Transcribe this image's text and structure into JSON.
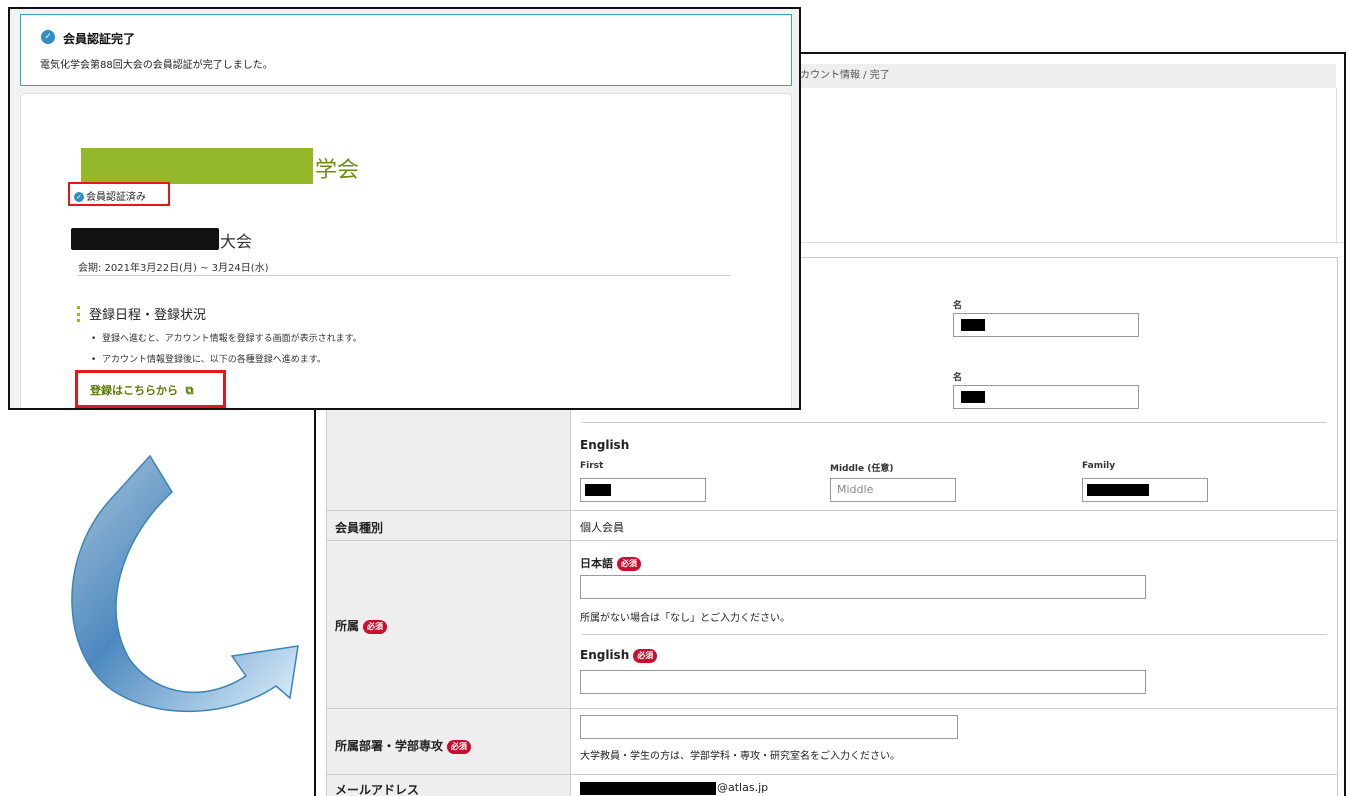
{
  "breadcrumb": "カウント情報 / 完了",
  "verify": {
    "alert_title": "会員認証完了",
    "alert_text": "電気化学会第88回大会の会員認証が完了しました。",
    "society_suffix": "学会",
    "verified_badge": "会員認証済み",
    "conference_suffix": "大会",
    "period": "会期: 2021年3月22日(月) ~ 3月24日(水)",
    "section_title": "登録日程・登録状況",
    "bullets": [
      "登録へ進むと、アカウント情報を登録する画面が表示されます。",
      "アカウント情報登録後に、以下の各種登録へ進めます。"
    ],
    "register_button": "登録はこちらから",
    "register_icon": "external-link-icon"
  },
  "form": {
    "given_name_label_1": "名",
    "given_name_label_2": "名",
    "english_label": "English",
    "first_label": "First",
    "middle_label": "Middle (任意)",
    "middle_placeholder": "Middle",
    "family_label": "Family",
    "membership_label": "会員種別",
    "membership_value": "個人会員",
    "affiliation_label": "所属",
    "affiliation_jp_label": "日本語",
    "affiliation_note": "所属がない場合は「なし」とご入力ください。",
    "affiliation_en_label": "English",
    "department_label": "所属部署・学部専攻",
    "department_note": "大学教員・学生の方は、学部学科・専攻・研究室名をご入力ください。",
    "email_label": "メールアドレス",
    "email_domain": "@atlas.jp",
    "required_badge": "必須"
  },
  "colors": {
    "accent_blue": "#2e8fc4",
    "highlight_red": "#e0191b",
    "society_green": "#94b82a",
    "required_red": "#c8102e"
  }
}
